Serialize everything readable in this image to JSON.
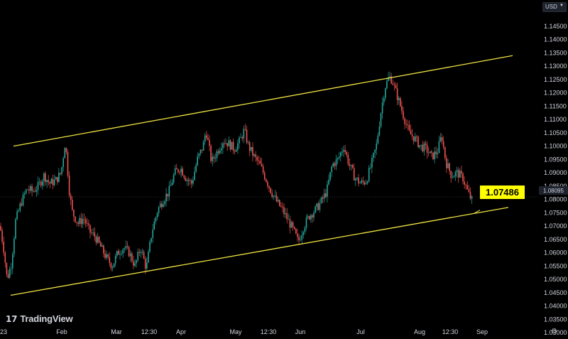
{
  "header": {
    "currency": "USD"
  },
  "branding": {
    "logo_mark": "17",
    "logo_text": "TradingView"
  },
  "callout": {
    "price": "1.07486"
  },
  "last_price_tag": "1.08095",
  "footer": {
    "year_fragment": "23"
  },
  "colors": {
    "up": "#26a69a",
    "down": "#ef5350",
    "channel": "#f0e442",
    "background": "#000000"
  },
  "icons": {
    "settings": "settings-icon",
    "caret": "chevron-down-icon"
  },
  "chart_data": {
    "type": "candlestick",
    "symbol_quote": "USD",
    "ylim": [
      1.03,
      1.145
    ],
    "y_ticks": [
      "1.14500",
      "1.14000",
      "1.13500",
      "1.13000",
      "1.12500",
      "1.12000",
      "1.11500",
      "1.11000",
      "1.10500",
      "1.10000",
      "1.09500",
      "1.09000",
      "1.08500",
      "1.08000",
      "1.07500",
      "1.07000",
      "1.06500",
      "1.06000",
      "1.05500",
      "1.05000",
      "1.04500",
      "1.04000",
      "1.03500",
      "1.03000"
    ],
    "x_ticks": [
      "Feb",
      "Mar",
      "12:30",
      "Apr",
      "May",
      "12:30",
      "Jun",
      "Jul",
      "Aug",
      "12:30",
      "Sep"
    ],
    "price_path": [
      [
        0,
        1.07
      ],
      [
        5,
        1.062
      ],
      [
        10,
        1.05
      ],
      [
        16,
        1.056
      ],
      [
        22,
        1.072
      ],
      [
        30,
        1.079
      ],
      [
        38,
        1.084
      ],
      [
        46,
        1.083
      ],
      [
        54,
        1.085
      ],
      [
        62,
        1.089
      ],
      [
        70,
        1.086
      ],
      [
        78,
        1.087
      ],
      [
        86,
        1.09
      ],
      [
        92,
        1.102
      ],
      [
        98,
        1.082
      ],
      [
        102,
        1.075
      ],
      [
        110,
        1.071
      ],
      [
        118,
        1.073
      ],
      [
        126,
        1.068
      ],
      [
        134,
        1.066
      ],
      [
        142,
        1.062
      ],
      [
        150,
        1.058
      ],
      [
        158,
        1.055
      ],
      [
        166,
        1.06
      ],
      [
        174,
        1.062
      ],
      [
        182,
        1.06
      ],
      [
        190,
        1.055
      ],
      [
        198,
        1.062
      ],
      [
        206,
        1.054
      ],
      [
        214,
        1.068
      ],
      [
        222,
        1.076
      ],
      [
        230,
        1.08
      ],
      [
        238,
        1.083
      ],
      [
        246,
        1.09
      ],
      [
        254,
        1.092
      ],
      [
        262,
        1.088
      ],
      [
        270,
        1.086
      ],
      [
        278,
        1.095
      ],
      [
        286,
        1.1
      ],
      [
        290,
        1.106
      ],
      [
        298,
        1.094
      ],
      [
        306,
        1.098
      ],
      [
        314,
        1.102
      ],
      [
        322,
        1.101
      ],
      [
        330,
        1.099
      ],
      [
        338,
        1.102
      ],
      [
        344,
        1.106
      ],
      [
        350,
        1.1
      ],
      [
        358,
        1.096
      ],
      [
        366,
        1.093
      ],
      [
        374,
        1.088
      ],
      [
        382,
        1.083
      ],
      [
        390,
        1.079
      ],
      [
        398,
        1.076
      ],
      [
        406,
        1.072
      ],
      [
        414,
        1.068
      ],
      [
        420,
        1.064
      ],
      [
        428,
        1.07
      ],
      [
        436,
        1.074
      ],
      [
        444,
        1.076
      ],
      [
        452,
        1.079
      ],
      [
        460,
        1.083
      ],
      [
        468,
        1.093
      ],
      [
        476,
        1.095
      ],
      [
        484,
        1.1
      ],
      [
        492,
        1.093
      ],
      [
        500,
        1.088
      ],
      [
        508,
        1.086
      ],
      [
        516,
        1.087
      ],
      [
        524,
        1.094
      ],
      [
        530,
        1.1
      ],
      [
        536,
        1.112
      ],
      [
        542,
        1.122
      ],
      [
        548,
        1.126
      ],
      [
        552,
        1.125
      ],
      [
        558,
        1.12
      ],
      [
        564,
        1.115
      ],
      [
        570,
        1.11
      ],
      [
        576,
        1.105
      ],
      [
        584,
        1.103
      ],
      [
        592,
        1.1
      ],
      [
        600,
        1.099
      ],
      [
        608,
        1.096
      ],
      [
        616,
        1.098
      ],
      [
        622,
        1.104
      ],
      [
        628,
        1.094
      ],
      [
        636,
        1.089
      ],
      [
        644,
        1.09
      ],
      [
        652,
        1.088
      ],
      [
        660,
        1.082
      ],
      [
        666,
        1.079
      ]
    ],
    "channel_upper": [
      [
        19,
        1.1
      ],
      [
        722,
        1.134
      ]
    ],
    "channel_lower": [
      [
        15,
        1.044
      ],
      [
        716,
        1.077
      ]
    ],
    "callout_pointer": [
      [
        668,
        1.0748
      ],
      [
        676,
        1.076
      ]
    ],
    "current_price_line": 1.08095
  }
}
